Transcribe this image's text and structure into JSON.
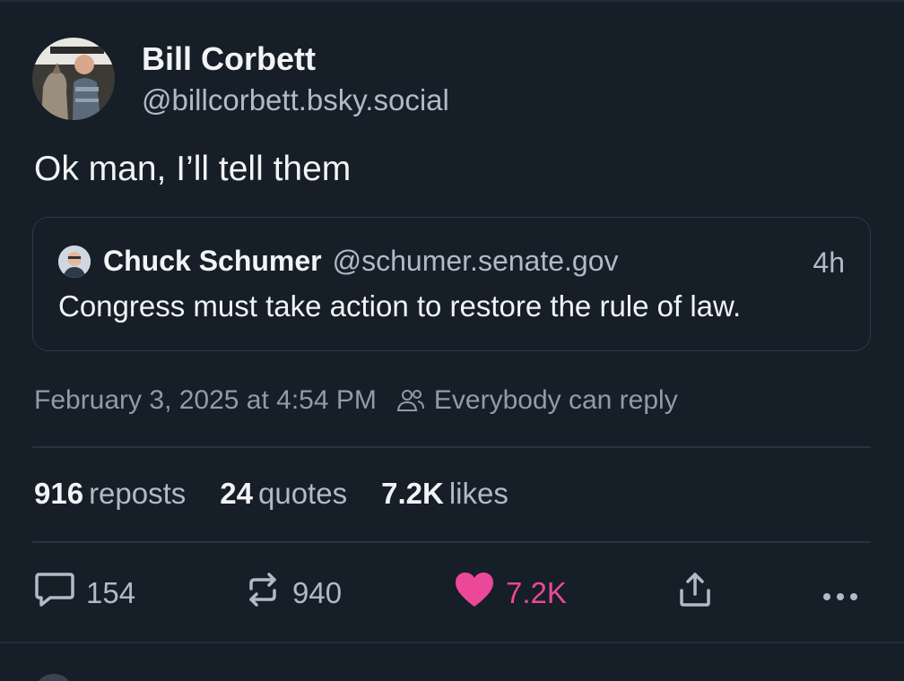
{
  "post": {
    "author": {
      "display_name": "Bill Corbett",
      "handle": "@billcorbett.bsky.social"
    },
    "text": "Ok man, I’ll tell them",
    "quote": {
      "display_name": "Chuck Schumer",
      "handle": "@schumer.senate.gov",
      "time": "4h",
      "text": "Congress must take action to restore the rule of law."
    },
    "timestamp": "February 3, 2025 at 4:54 PM",
    "reply_setting": "Everybody can reply",
    "stats": {
      "reposts_count": "916",
      "reposts_label": "reposts",
      "quotes_count": "24",
      "quotes_label": "quotes",
      "likes_count": "7.2K",
      "likes_label": "likes"
    },
    "actions": {
      "reply_count": "154",
      "repost_count": "940",
      "like_count": "7.2K"
    }
  },
  "colors": {
    "background": "#161e27",
    "text_primary": "#f1f3f5",
    "text_secondary": "#aebbc9",
    "like_accent": "#ec4899",
    "border": "#2e3946"
  },
  "icons": {
    "reply": "speech-bubble-icon",
    "repost": "repost-arrows-icon",
    "like": "heart-icon",
    "share": "share-icon",
    "more": "ellipsis-icon",
    "reply_setting": "people-icon"
  }
}
